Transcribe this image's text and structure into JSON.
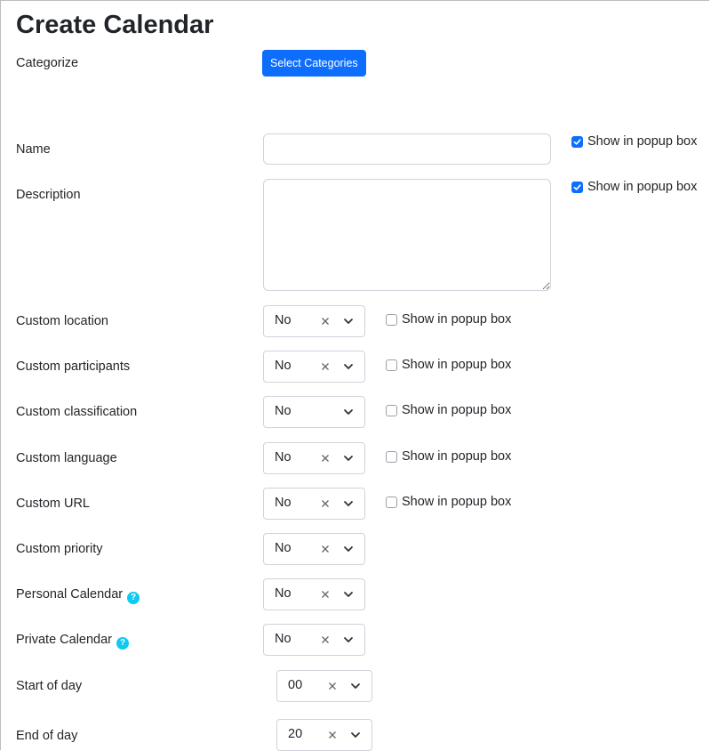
{
  "page": {
    "title": "Create Calendar"
  },
  "categorize": {
    "label": "Categorize",
    "button_label": "Select Categories"
  },
  "name_field": {
    "label": "Name",
    "value": "",
    "popup_label": "Show in popup box",
    "popup_checked": true
  },
  "description_field": {
    "label": "Description",
    "value": "",
    "popup_label": "Show in popup box",
    "popup_checked": true
  },
  "custom_fields": [
    {
      "label": "Custom location",
      "value": "No",
      "clearable": true,
      "popup_label": "Show in popup box",
      "popup_checked": false
    },
    {
      "label": "Custom participants",
      "value": "No",
      "clearable": true,
      "popup_label": "Show in popup box",
      "popup_checked": false
    },
    {
      "label": "Custom classification",
      "value": "No",
      "clearable": false,
      "popup_label": "Show in popup box",
      "popup_checked": false
    },
    {
      "label": "Custom language",
      "value": "No",
      "clearable": true,
      "popup_label": "Show in popup box",
      "popup_checked": false
    },
    {
      "label": "Custom URL",
      "value": "No",
      "clearable": true,
      "popup_label": "Show in popup box",
      "popup_checked": false
    }
  ],
  "options": [
    {
      "label": "Custom priority",
      "value": "No",
      "help": false
    },
    {
      "label": "Personal Calendar",
      "value": "No",
      "help": true
    },
    {
      "label": "Private Calendar",
      "value": "No",
      "help": true
    }
  ],
  "start_of_day": {
    "label": "Start of day",
    "value": "00"
  },
  "end_of_day": {
    "label": "End of day",
    "value": "20"
  },
  "icons": {
    "help": "question-circle-icon",
    "clear": "close-icon",
    "dropdown": "chevron-down-icon",
    "check": "check-icon"
  },
  "colors": {
    "primary": "#0d6efd",
    "help": "#0dcaf0"
  }
}
